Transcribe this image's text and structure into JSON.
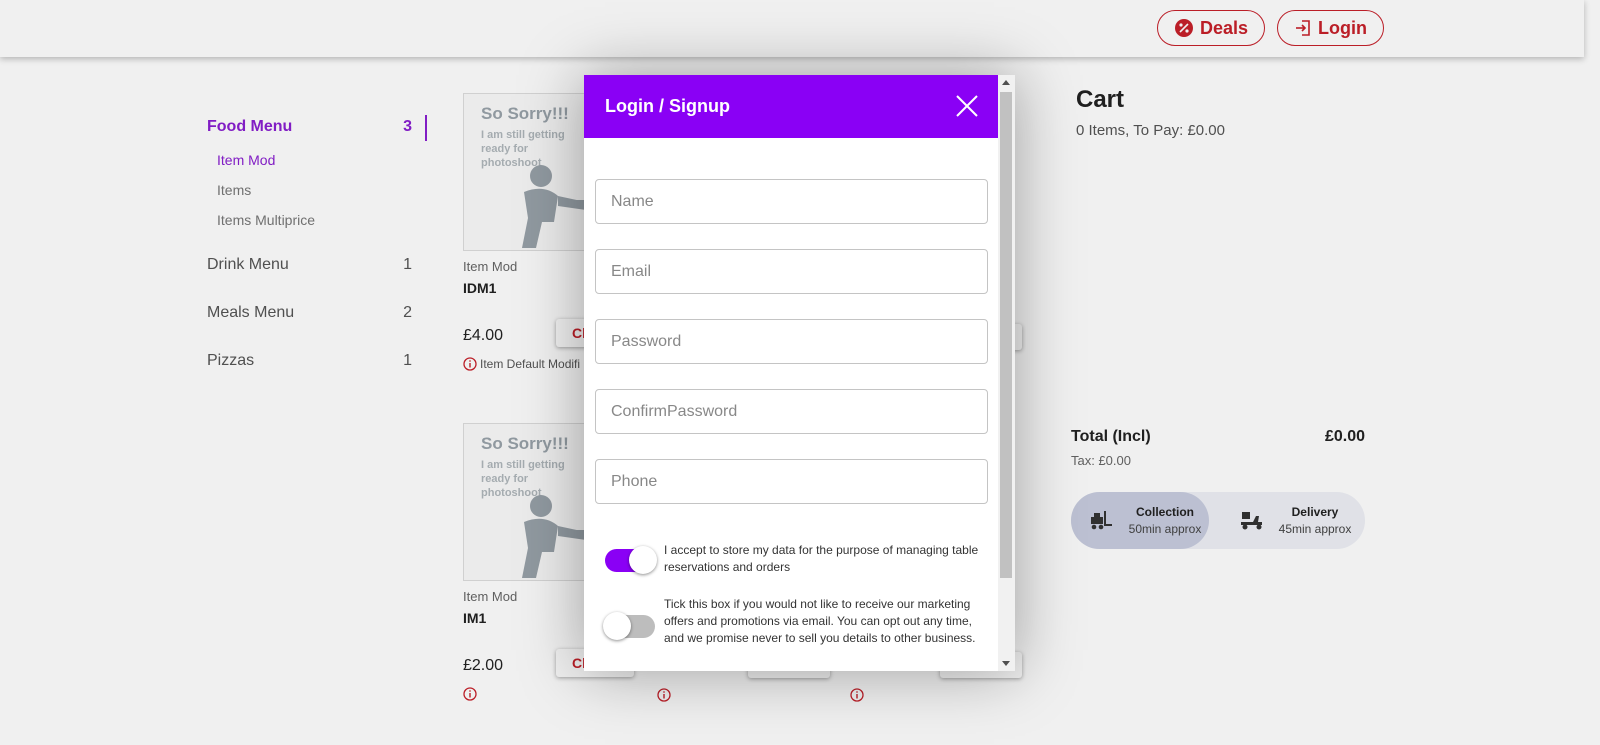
{
  "header": {
    "deals_label": "Deals",
    "login_label": "Login"
  },
  "sidebar": {
    "sections": [
      {
        "label": "Food Menu",
        "count": "3",
        "active": true,
        "items": [
          {
            "label": "Item Mod",
            "active": true
          },
          {
            "label": "Items"
          },
          {
            "label": "Items Multiprice"
          }
        ]
      },
      {
        "label": "Drink Menu",
        "count": "1"
      },
      {
        "label": "Meals Menu",
        "count": "2"
      },
      {
        "label": "Pizzas",
        "count": "1"
      }
    ]
  },
  "products": [
    {
      "placeholder_title": "So Sorry!!!",
      "placeholder_sub": "I am still getting ready for photoshoot",
      "category": "Item Mod",
      "code": "IDM1",
      "price": "£4.00",
      "choose_label": "Ch",
      "modifier_note": "Item Default Modifi"
    },
    {
      "placeholder_title": "So Sorry!!!",
      "placeholder_sub": "I am still getting ready for photoshoot",
      "category": "Item Mod",
      "code": "IM1",
      "price": "£2.00",
      "choose_label": "Ch",
      "modifier_note": ""
    }
  ],
  "cart": {
    "title": "Cart",
    "summary": "0 Items, To Pay: £0.00",
    "total_label": "Total (Incl)",
    "total_value": "£0.00",
    "tax": "Tax: £0.00",
    "modes": [
      {
        "name": "Collection",
        "time": "50min approx",
        "selected": true,
        "icon": "forklift-icon"
      },
      {
        "name": "Delivery",
        "time": "45min approx",
        "selected": false,
        "icon": "scooter-icon"
      }
    ]
  },
  "modal": {
    "title": "Login / Signup",
    "fields": [
      {
        "placeholder": "Name",
        "value": ""
      },
      {
        "placeholder": "Email",
        "value": ""
      },
      {
        "placeholder": "Password",
        "value": ""
      },
      {
        "placeholder": "ConfirmPassword",
        "value": ""
      },
      {
        "placeholder": "Phone",
        "value": ""
      }
    ],
    "consents": [
      {
        "text": "I accept to store my data for the purpose of managing table reservations and orders",
        "on": true
      },
      {
        "text": "Tick this box if you would not like to receive our marketing offers and promotions via email. You can opt out any time, and we promise never to sell you details to other business.",
        "on": false
      }
    ]
  },
  "colors": {
    "accent": "#8a00f5",
    "brand_red": "#c7202a",
    "menu_active": "#8a1fd1"
  }
}
